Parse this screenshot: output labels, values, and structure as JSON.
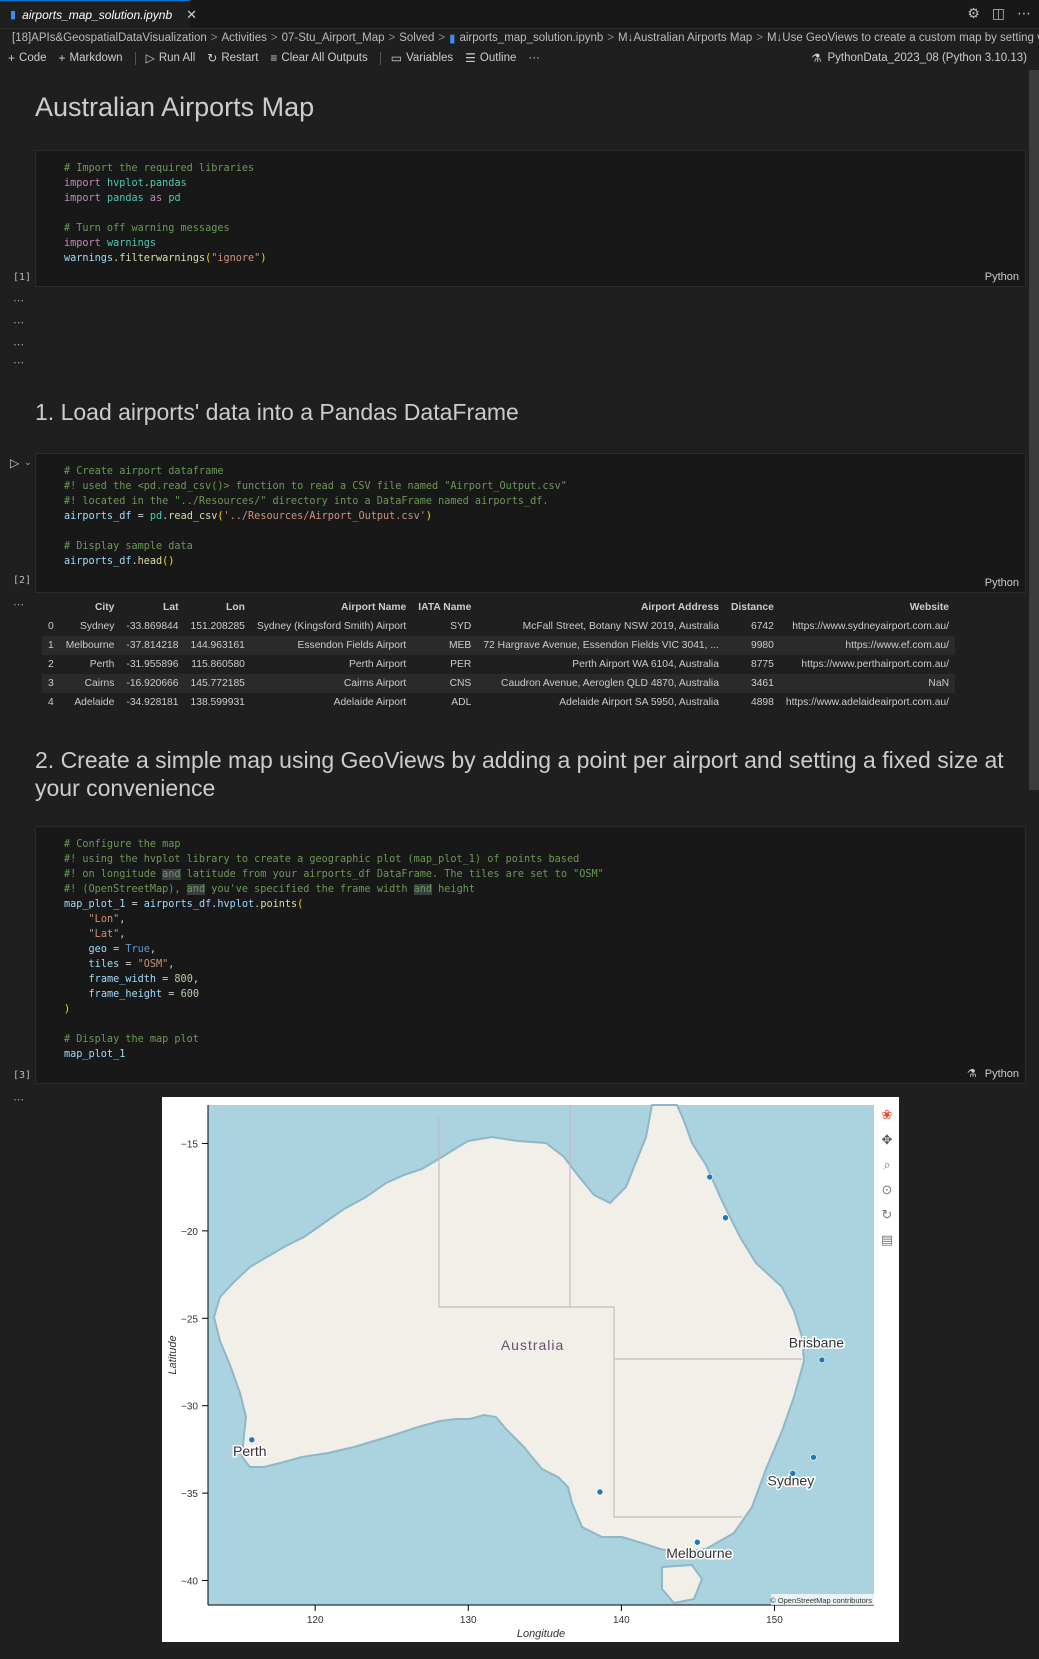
{
  "tab": {
    "filename": "airports_map_solution.ipynb",
    "close": "✕"
  },
  "breadcrumb": [
    "[18]APIs&GeospatialDataVisualization",
    "Activities",
    "07-Stu_Airport_Map",
    "Solved",
    "airports_map_solution.ipynb",
    "M↓Australian Airports Map",
    "M↓Use GeoViews to create a custom map by setting val"
  ],
  "toolbar": {
    "code": "Code",
    "markdown": "Markdown",
    "run_all": "Run All",
    "restart": "Restart",
    "clear": "Clear All Outputs",
    "variables": "Variables",
    "outline": "Outline",
    "more": "···"
  },
  "kernel": "PythonData_2023_08 (Python 3.10.13)",
  "headings": {
    "h1": "Australian Airports Map",
    "h2": "1. Load airports' data into a Pandas DataFrame",
    "h3a": "2. Create a simple map using GeoViews by adding a point per airport and setting a fixed size at",
    "h3b": "your convenience"
  },
  "cells": {
    "c1_count": "[1]",
    "c2_count": "[2]",
    "c3_count": "[3]",
    "lang": "Python"
  },
  "dataframe": {
    "columns": [
      "",
      "City",
      "Lat",
      "Lon",
      "Airport Name",
      "IATA Name",
      "Airport Address",
      "Distance",
      "Website"
    ],
    "rows": [
      [
        "0",
        "Sydney",
        "-33.869844",
        "151.208285",
        "Sydney (Kingsford Smith) Airport",
        "SYD",
        "McFall Street, Botany NSW 2019, Australia",
        "6742",
        "https://www.sydneyairport.com.au/"
      ],
      [
        "1",
        "Melbourne",
        "-37.814218",
        "144.963161",
        "Essendon Fields Airport",
        "MEB",
        "72 Hargrave Avenue, Essendon Fields VIC 3041, ...",
        "9980",
        "https://www.ef.com.au/"
      ],
      [
        "2",
        "Perth",
        "-31.955896",
        "115.860580",
        "Perth Airport",
        "PER",
        "Perth Airport WA 6104, Australia",
        "8775",
        "https://www.perthairport.com.au/"
      ],
      [
        "3",
        "Cairns",
        "-16.920666",
        "145.772185",
        "Cairns Airport",
        "CNS",
        "Caudron Avenue, Aeroglen QLD 4870, Australia",
        "3461",
        "NaN"
      ],
      [
        "4",
        "Adelaide",
        "-34.928181",
        "138.599931",
        "Adelaide Airport",
        "ADL",
        "Adelaide Airport SA 5950, Australia",
        "4898",
        "https://www.adelaideairport.com.au/"
      ]
    ]
  },
  "map": {
    "xlabel": "Longitude",
    "ylabel": "Latitude",
    "xticks": [
      120,
      130,
      140,
      150
    ],
    "yticks": [
      -15,
      -20,
      -25,
      -30,
      -35,
      -40
    ],
    "xlim": [
      113,
      156.5
    ],
    "ylim": [
      -41.4,
      -12.8
    ],
    "country": "Australia",
    "cities": [
      {
        "name": "Brisbane",
        "lon": 153.0,
        "lat": -27.47
      },
      {
        "name": "Sydney",
        "lon": 151.2,
        "lat": -33.87
      },
      {
        "name": "Perth",
        "lon": 115.86,
        "lat": -31.95
      },
      {
        "name": "Melbourne",
        "lon": 144.96,
        "lat": -37.81
      }
    ],
    "points": [
      {
        "lon": 145.77,
        "lat": -16.92
      },
      {
        "lon": 146.8,
        "lat": -19.25
      },
      {
        "lon": 153.1,
        "lat": -27.38
      },
      {
        "lon": 151.2,
        "lat": -33.87
      },
      {
        "lon": 152.55,
        "lat": -32.95
      },
      {
        "lon": 115.86,
        "lat": -31.95
      },
      {
        "lon": 138.6,
        "lat": -34.93
      },
      {
        "lon": 144.96,
        "lat": -37.81
      }
    ],
    "attribution": "© OpenStreetMap contributors",
    "colors": {
      "ocean": "#aad3df",
      "land": "#f2efe9",
      "point": "#1f77b4"
    }
  }
}
